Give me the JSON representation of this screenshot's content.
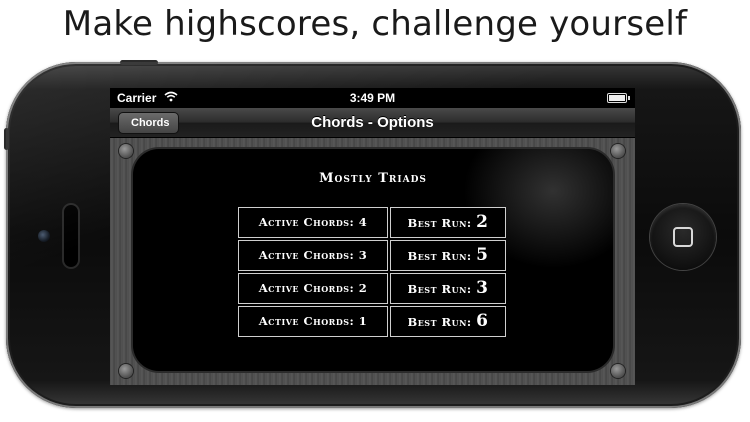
{
  "headline": "Make highscores, challenge yourself",
  "status_bar": {
    "carrier": "Carrier",
    "time": "3:49 PM"
  },
  "nav": {
    "back_label": "Chords",
    "title": "Chords - Options"
  },
  "panel": {
    "title": "Mostly Triads",
    "rows": [
      {
        "chords_label": "Active Chords: 4",
        "run_label": "Best Run:",
        "run_value": "2"
      },
      {
        "chords_label": "Active Chords: 3",
        "run_label": "Best Run:",
        "run_value": "5"
      },
      {
        "chords_label": "Active Chords: 2",
        "run_label": "Best Run:",
        "run_value": "3"
      },
      {
        "chords_label": "Active Chords: 1",
        "run_label": "Best Run:",
        "run_value": "6"
      }
    ]
  },
  "icons": {
    "wifi": "wifi-icon",
    "battery": "battery-icon",
    "home": "home-button-icon"
  }
}
